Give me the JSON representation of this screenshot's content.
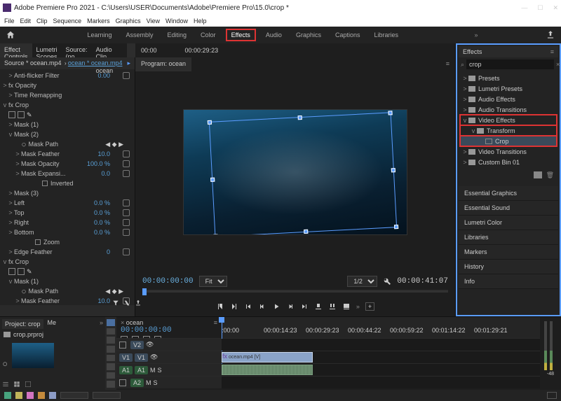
{
  "title": "Adobe Premiere Pro 2021 - C:\\Users\\USER\\Documents\\Adobe\\Premiere Pro\\15.0\\crop *",
  "menu": [
    "File",
    "Edit",
    "Clip",
    "Sequence",
    "Markers",
    "Graphics",
    "View",
    "Window",
    "Help"
  ],
  "workspaces": {
    "items": [
      "Learning",
      "Assembly",
      "Editing",
      "Color",
      "Effects",
      "Audio",
      "Graphics",
      "Captions",
      "Libraries"
    ],
    "active": "Effects"
  },
  "effectControls": {
    "tabs": [
      "Effect Controls",
      "Lumetri Scopes",
      "Source: (no clips)",
      "Audio Clip Mixer: ocean"
    ],
    "source": "Source * ocean.mp4",
    "link": "ocean * ocean.mp4",
    "ruler": [
      "00:00",
      "00:00:29:23"
    ],
    "rows": [
      {
        "i": 1,
        "a": ">",
        "l": "Anti-flicker Filter",
        "v": "0.00",
        "reset": true
      },
      {
        "i": 0,
        "a": ">",
        "l": "fx  Opacity"
      },
      {
        "i": 1,
        "a": ">",
        "l": "Time Remapping"
      },
      {
        "i": 0,
        "a": "v",
        "l": "fx  Crop",
        "shapes": true
      },
      {
        "i": 1,
        "a": ">",
        "l": "Mask (1)"
      },
      {
        "i": 1,
        "a": "v",
        "l": "Mask (2)"
      },
      {
        "i": 2,
        "a": "",
        "l": "Mask Path",
        "kf": true
      },
      {
        "i": 2,
        "a": ">",
        "l": "Mask Feather",
        "v": "10.0",
        "reset": true
      },
      {
        "i": 2,
        "a": ">",
        "l": "Mask Opacity",
        "v": "100.0 %",
        "reset": true
      },
      {
        "i": 2,
        "a": ">",
        "l": "Mask Expansi...",
        "v": "0.0",
        "reset": true
      },
      {
        "i": 3,
        "a": "",
        "l": "Inverted",
        "chk": true
      },
      {
        "i": 1,
        "a": ">",
        "l": "Mask (3)"
      },
      {
        "i": 1,
        "a": ">",
        "l": "Left",
        "v": "0.0 %",
        "reset": true
      },
      {
        "i": 1,
        "a": ">",
        "l": "Top",
        "v": "0.0 %",
        "reset": true
      },
      {
        "i": 1,
        "a": ">",
        "l": "Right",
        "v": "0.0 %",
        "reset": true
      },
      {
        "i": 1,
        "a": ">",
        "l": "Bottom",
        "v": "0.0 %",
        "reset": true
      },
      {
        "i": 2,
        "a": "",
        "l": "Zoom",
        "chk": true
      },
      {
        "i": 1,
        "a": ">",
        "l": "Edge Feather",
        "v": "0",
        "reset": true
      },
      {
        "i": 0,
        "a": "v",
        "l": "fx  Crop",
        "shapes": true
      },
      {
        "i": 1,
        "a": "v",
        "l": "Mask (1)"
      },
      {
        "i": 2,
        "a": "",
        "l": "Mask Path",
        "kf": true
      },
      {
        "i": 2,
        "a": ">",
        "l": "Mask Feather",
        "v": "10.0",
        "reset": true
      }
    ]
  },
  "program": {
    "tab": "Program: ocean",
    "tc_in": "00:00:00:00",
    "fit": "Fit",
    "frac": "1/2",
    "tc_out": "00:00:41:07"
  },
  "effectsPanel": {
    "title": "Effects",
    "search": "crop",
    "tree": [
      {
        "i": 0,
        "a": ">",
        "f": true,
        "l": "Presets"
      },
      {
        "i": 0,
        "a": ">",
        "f": true,
        "l": "Lumetri Presets"
      },
      {
        "i": 0,
        "a": ">",
        "f": true,
        "l": "Audio Effects"
      },
      {
        "i": 0,
        "a": ">",
        "f": true,
        "l": "Audio Transitions"
      },
      {
        "i": 0,
        "a": "v",
        "f": true,
        "l": "Video Effects",
        "hl": true
      },
      {
        "i": 1,
        "a": "v",
        "f": true,
        "l": "Transform",
        "hl": true
      },
      {
        "i": 2,
        "a": "",
        "f": false,
        "l": "Crop",
        "hl": true,
        "sel": true
      },
      {
        "i": 0,
        "a": ">",
        "f": true,
        "l": "Video Transitions"
      },
      {
        "i": 0,
        "a": ">",
        "f": true,
        "l": "Custom Bin 01"
      }
    ],
    "panels": [
      "Essential Graphics",
      "Essential Sound",
      "Lumetri Color",
      "Libraries",
      "Markers",
      "History",
      "Info"
    ]
  },
  "project": {
    "tabs": [
      "Project: crop",
      "Me"
    ],
    "file": "crop.prproj"
  },
  "timeline": {
    "tab": "ocean",
    "tc": "00:00:00:00",
    "ruler": [
      ":00:00",
      "00:00:14:23",
      "00:00:29:23",
      "00:00:44:22",
      "00:00:59:22",
      "00:01:14:22",
      "00:01:29:21"
    ],
    "vclip": "ocean.mp4 [V]",
    "tracks": {
      "v2": "V2",
      "v1": "V1",
      "a1": "A1",
      "a2": "A2"
    }
  },
  "statusColors": [
    "#47a37e",
    "#c0b55a",
    "#d174c0",
    "#c48a3c",
    "#8c9cc6"
  ],
  "meterDb": "-48"
}
